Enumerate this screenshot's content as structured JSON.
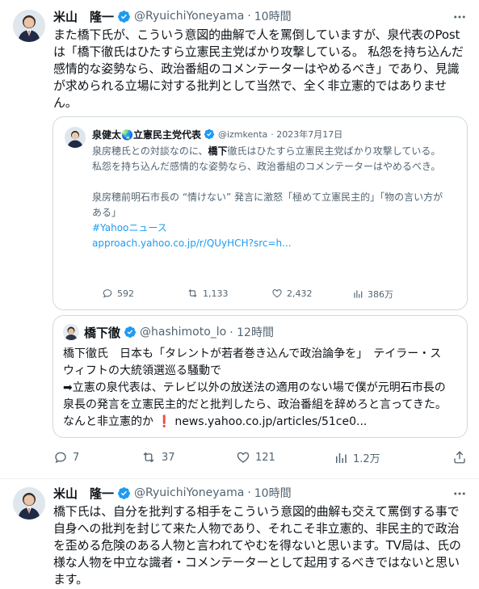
{
  "colors": {
    "accent": "#1d9bf0",
    "text": "#0f1419",
    "muted": "#536471",
    "border": "#cfd9de",
    "red": "#f4212e"
  },
  "tweet1": {
    "author_name": "米山　隆一",
    "handle": "@RyuichiYoneyama",
    "dot": "·",
    "time": "10時間",
    "text": "また橋下氏が、こういう意図的曲解で人を罵倒していますが、泉代表のPostは「橋下徹氏はひたすら立憲民主党ばかり攻撃している。 私怨を持ち込んだ感情的な姿勢なら、政治番組のコメンテーターはやめるべき」であり、見識が求められる立場に対する批判として当然で、全く非立憲的ではありません。",
    "quote1": {
      "author_name": "泉健太🌏立憲民主党代表",
      "handle": "@izmkenta",
      "date": "· 2023年7月17日",
      "line1_pre": "泉房穂氏との対談なのに、",
      "line1_bold": "橋下",
      "line1_post": "徹氏はひたすら立憲民主党ばかり攻撃している。",
      "line2": "私怨を持ち込んだ感情的な姿勢なら、政治番組のコメンテーターはやめるべき。",
      "line3": "泉房穂前明石市長の “情けない” 発言に激怒「極めて立憲民主的」「物の言い方がある」",
      "hashtag": "#Yahooニュース",
      "url": "approach.yahoo.co.jp/r/QUyHCH?src=h...",
      "stats": {
        "replies": "592",
        "retweets": "1,133",
        "likes": "2,432",
        "views": "386万"
      }
    },
    "quote2": {
      "author_name": "橋下徹",
      "handle": "@hashimoto_lo",
      "time": "· 12時間",
      "line1": "橋下徹氏　日本も「タレントが若者巻き込んで政治論争を」　テイラー・スウィフトの大統領選巡る騒動で",
      "line2": "➡立憲の泉代表は、テレビ以外の放送法の適用のない場で僕が元明石市長の泉長の発言を立憲民主的だと批判したら、政治番組を辞めろと言ってきた。なんと非立憲的か",
      "exclaim": "❗",
      "link": "news.yahoo.co.jp/articles/51ce0..."
    },
    "stats": {
      "replies": "7",
      "retweets": "37",
      "likes": "121",
      "views": "1.2万"
    }
  },
  "tweet2": {
    "author_name": "米山　隆一",
    "handle": "@RyuichiYoneyama",
    "dot": "·",
    "time": "10時間",
    "text": "橋下氏は、自分を批判する相手をこういう意図的曲解も交えて罵倒する事で自身への批判を封じて来た人物であり、それこそ非立憲的、非民主的で政治を歪める危険のある人物と言われてやむを得ないと思います。TV局は、氏の様な人物を中立な識者・コメンテーターとして起用するべきではないと思います。"
  },
  "icons": [
    "more-icon",
    "verified-icon",
    "reply-icon",
    "retweet-icon",
    "like-icon",
    "views-icon",
    "share-icon",
    "globe-icon"
  ]
}
